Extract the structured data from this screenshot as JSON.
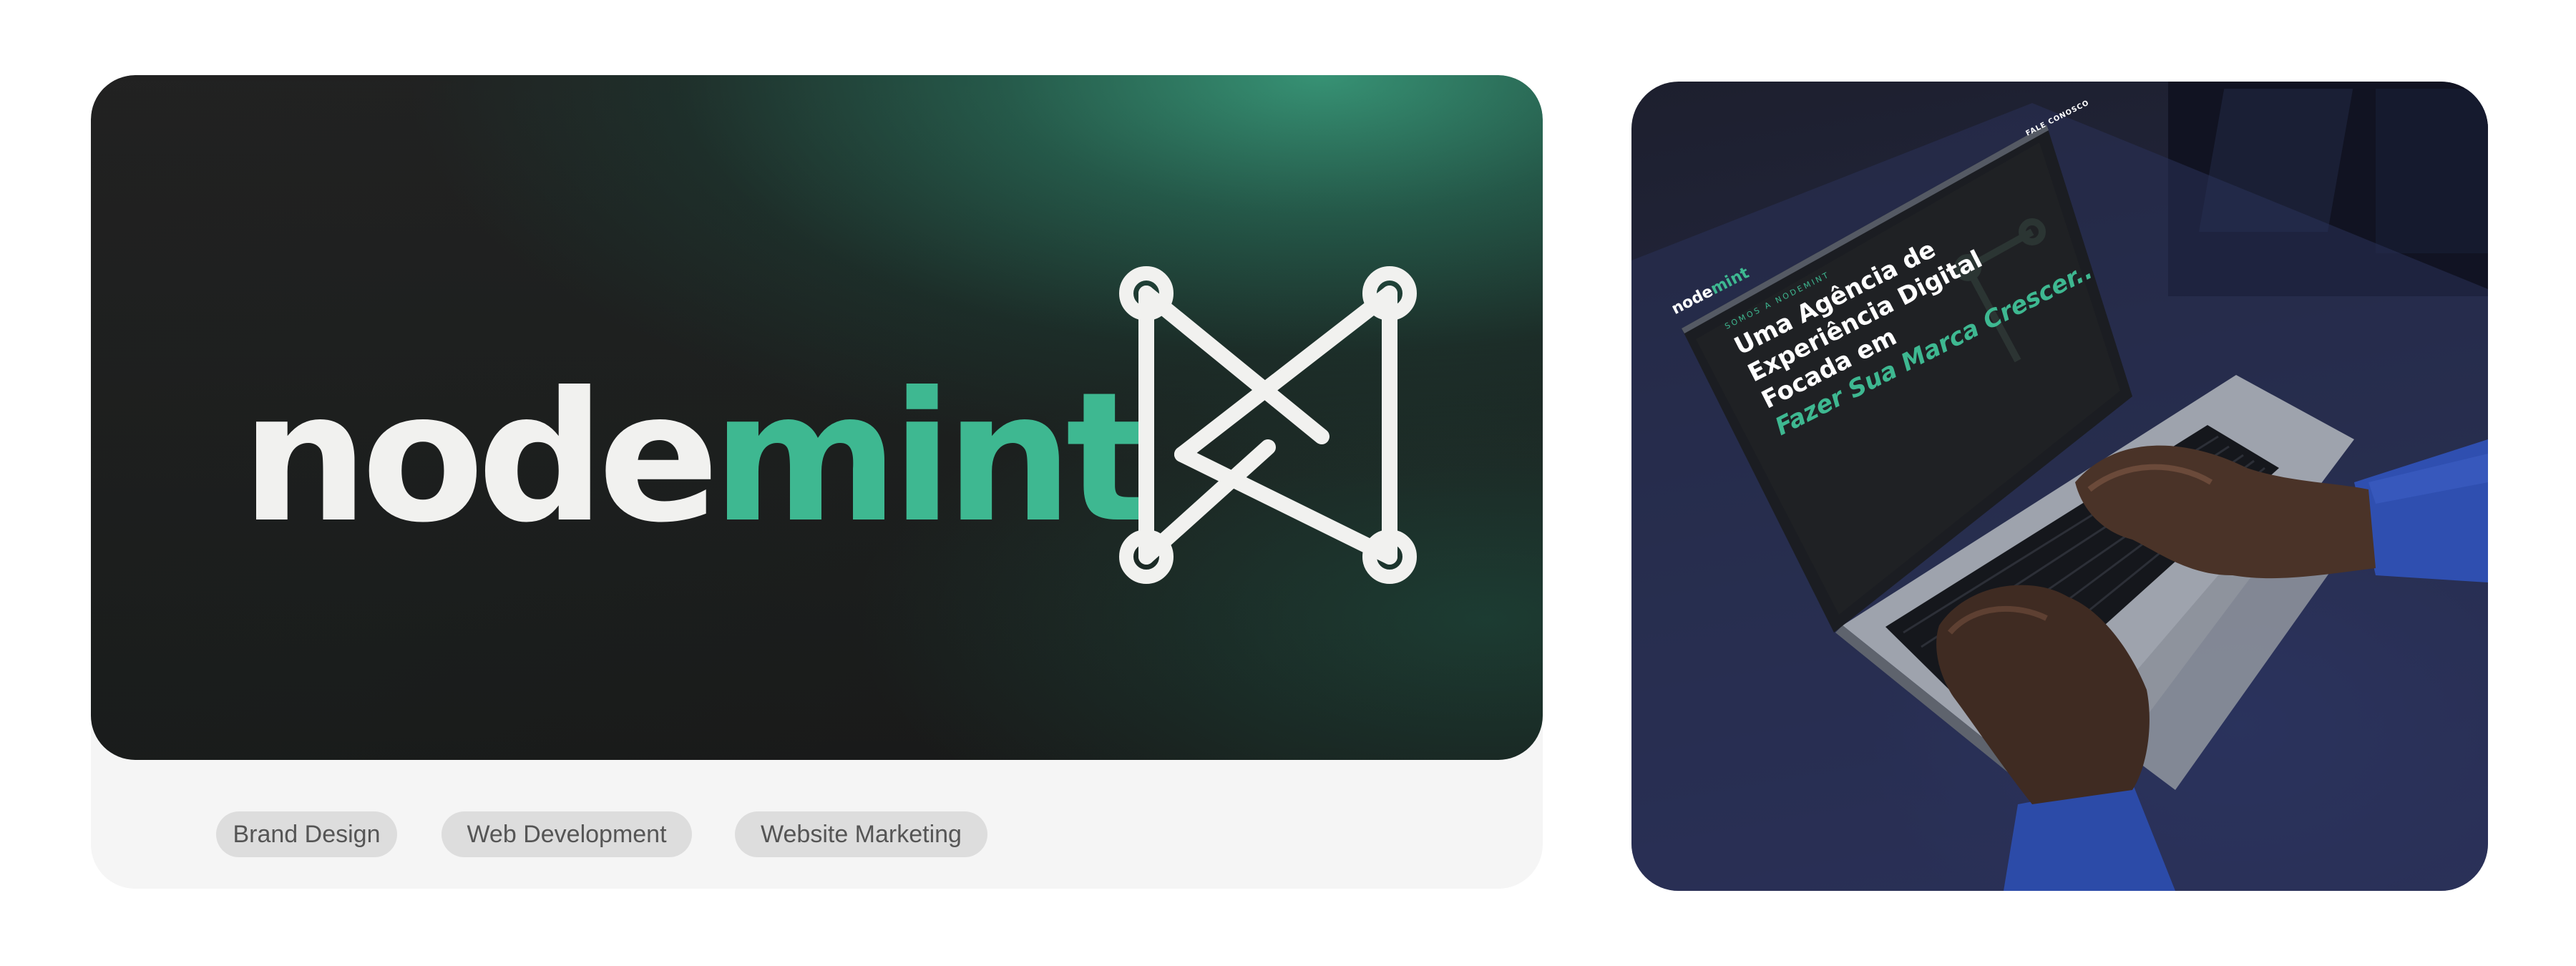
{
  "brand": {
    "wordmark_part1": "node",
    "wordmark_part2": "mint",
    "mark_icon": "nodemint-n-logo-icon"
  },
  "tags": [
    {
      "label": "Brand Design"
    },
    {
      "label": "Web Development"
    },
    {
      "label": "Website Marketing"
    }
  ],
  "photo": {
    "screen": {
      "logo_part1": "node",
      "logo_part2": "mint",
      "kicker": "SOMOS A NODEMINT",
      "headline_1": "Uma Agência de",
      "headline_2": "Experiência Digital",
      "headline_3": "Focada em",
      "headline_4": "Fazer Sua Marca Crescer..",
      "cta": "FALE CONOSCO"
    }
  },
  "colors": {
    "mint": "#3eb891",
    "wordmark_light": "#f1f1ef",
    "hero_dark": "#1a1a1a",
    "tag_bg": "#dddddd",
    "tag_text": "#555555"
  }
}
